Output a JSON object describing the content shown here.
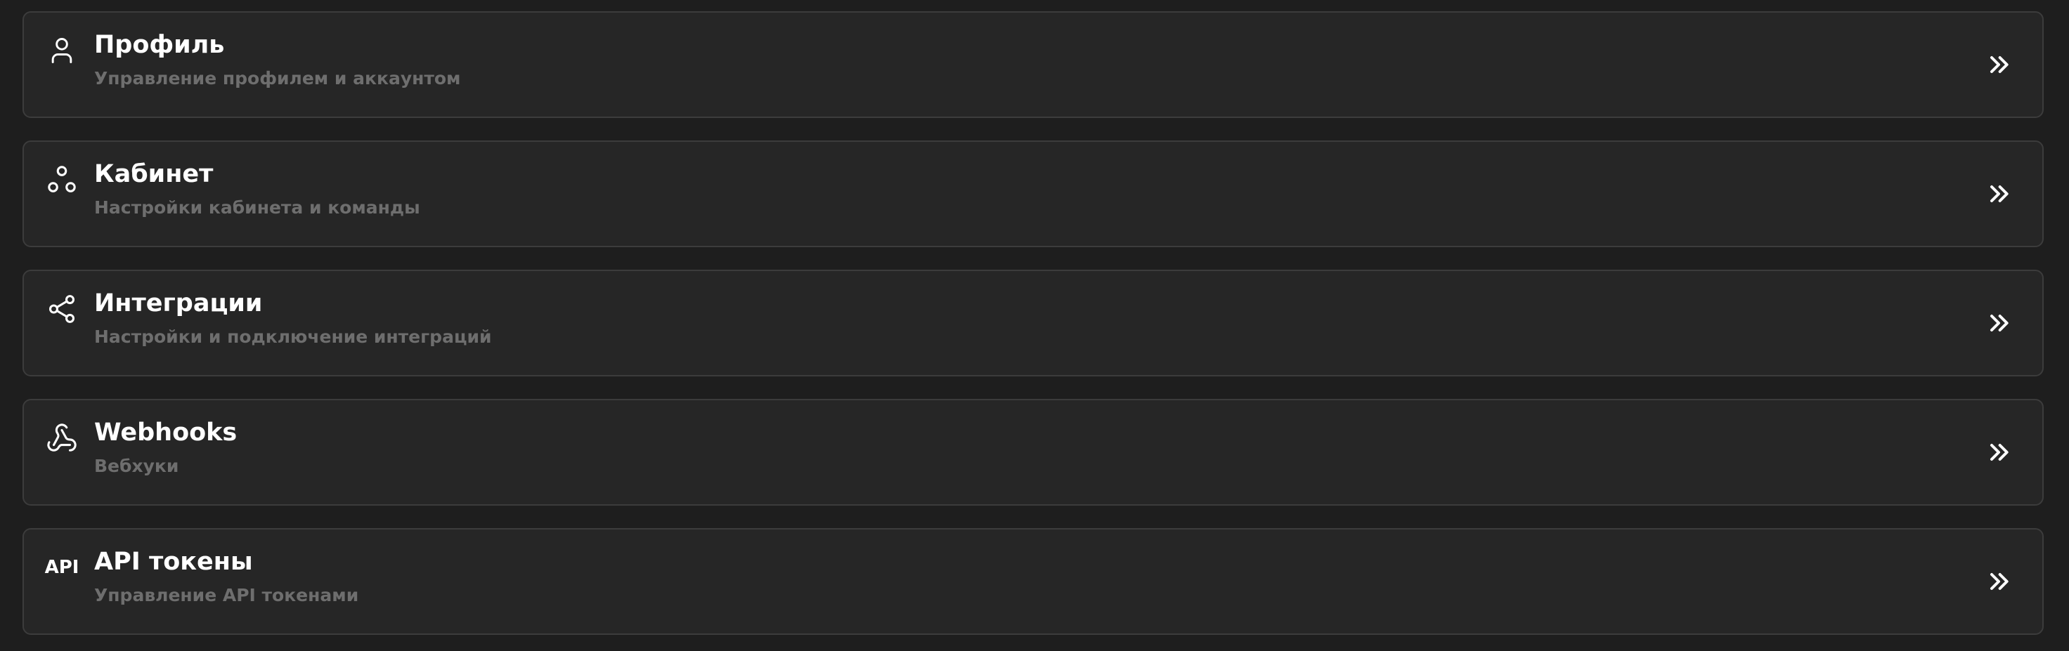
{
  "settings": {
    "items": [
      {
        "title": "Профиль",
        "subtitle": "Управление профилем и аккаунтом",
        "icon": "user-icon"
      },
      {
        "title": "Кабинет",
        "subtitle": "Настройки кабинета и команды",
        "icon": "team-icon"
      },
      {
        "title": "Интеграции",
        "subtitle": "Настройки и подключение интеграций",
        "icon": "share-icon"
      },
      {
        "title": "Webhooks",
        "subtitle": "Вебхуки",
        "icon": "webhook-icon"
      },
      {
        "title": "API токены",
        "subtitle": "Управление API токенами",
        "icon": "api-icon",
        "icon_text": "API"
      }
    ],
    "arrow_icon": "chevrons-right-icon"
  },
  "colors": {
    "background": "#1e1e1e",
    "card_background": "#262626",
    "card_border": "#3c3c3c",
    "title": "#ffffff",
    "subtitle": "#6e6e6e"
  }
}
